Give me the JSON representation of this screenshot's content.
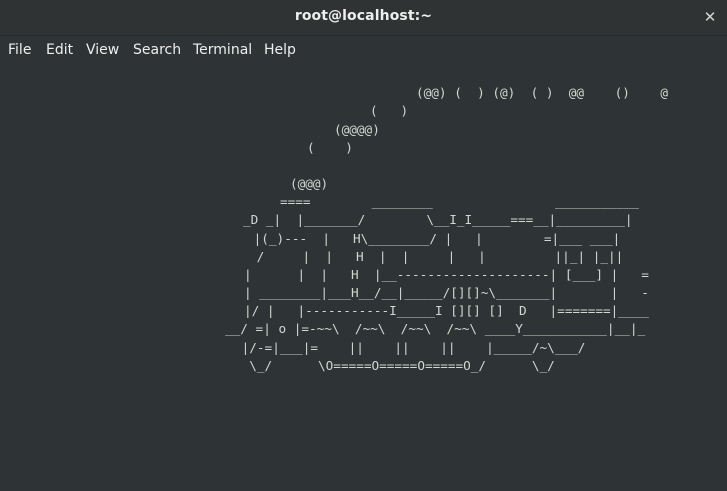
{
  "window": {
    "title": "root@localhost:~",
    "close_glyph": "✕"
  },
  "menu": {
    "items": [
      {
        "label": "File"
      },
      {
        "label": "Edit"
      },
      {
        "label": "View"
      },
      {
        "label": "Search"
      },
      {
        "label": "Terminal"
      },
      {
        "label": "Help"
      }
    ]
  },
  "terminal": {
    "lines": [
      "(@@) (  ) (@)  ( )  @@    ()    @",
      "(   )",
      "(@@@@)",
      "(    )",
      "",
      "(@@@)",
      "====        ________                ___________",
      "_D _|  |_______/        \\__I_I_____===__|_________|",
      " |(_)---  |   H\\________/ |   |        =|___ ___|",
      " /     |  |   H  |  |     |   |         ||_| |_||",
      "|      |  |   H  |__--------------------| [___] |   =",
      "| ________|___H__/__|_____/[][]~\\_______|       |   -",
      "|/ |   |-----------I_____I [][] []  D   |=======|____",
      "__/ =| o |=-~~\\  /~~\\  /~~\\  /~~\\ ____Y___________|__|_",
      " |/-=|___|=    ||    ||    ||    |_____/~\\___/",
      "  \\_/      \\O=====O=====O=====O_/      \\_/"
    ]
  }
}
